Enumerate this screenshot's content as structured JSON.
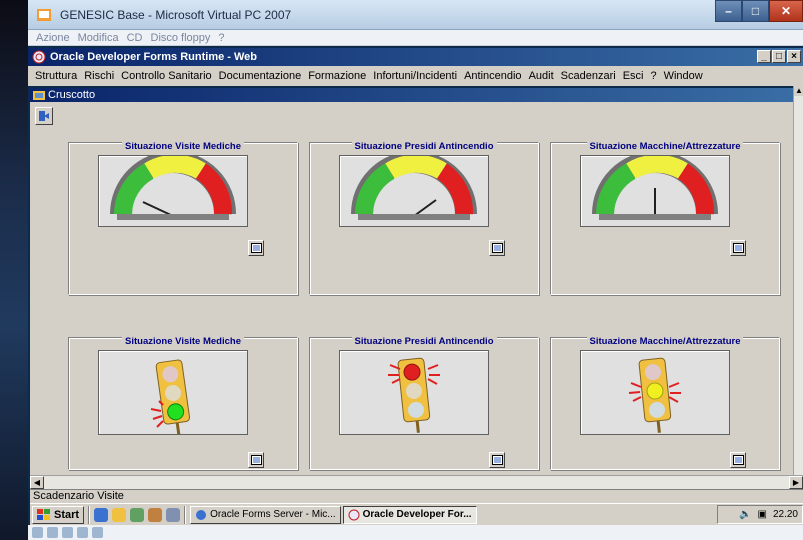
{
  "vpc": {
    "title": "GENESIC Base - Microsoft Virtual PC 2007",
    "menu": [
      "Azione",
      "Modifica",
      "CD",
      "Disco floppy",
      "?"
    ]
  },
  "oracle": {
    "title": "Oracle Developer Forms Runtime - Web",
    "menu": [
      "Struttura",
      "Rischi",
      "Controllo Sanitario",
      "Documentazione",
      "Formazione",
      "Infortuni/Incidenti",
      "Antincendio",
      "Audit",
      "Scadenzari",
      "Esci",
      "?",
      "Window"
    ]
  },
  "cruscotto": {
    "title": "Cruscotto",
    "panels_top": [
      {
        "label": "Situazione Visite Mediche",
        "gauge": "green"
      },
      {
        "label": "Situazione Presidi Antincendio",
        "gauge": "yellow-green"
      },
      {
        "label": "Situazione Macchine/Attrezzature",
        "gauge": "center"
      }
    ],
    "panels_bottom": [
      {
        "label": "Situazione Visite Mediche",
        "light": "green"
      },
      {
        "label": "Situazione Presidi Antincendio",
        "light": "red"
      },
      {
        "label": "Situazione Macchine/Attrezzature",
        "light": "yellow"
      }
    ]
  },
  "status": "Scadenzario Visite",
  "taskbar": {
    "start": "Start",
    "btn1": "Oracle Forms Server - Mic...",
    "btn2": "Oracle Developer For...",
    "clock": "22.20"
  },
  "colors": {
    "titlebar": "#0a246a",
    "panel_label": "#000080",
    "face": "#d4d0c8"
  }
}
